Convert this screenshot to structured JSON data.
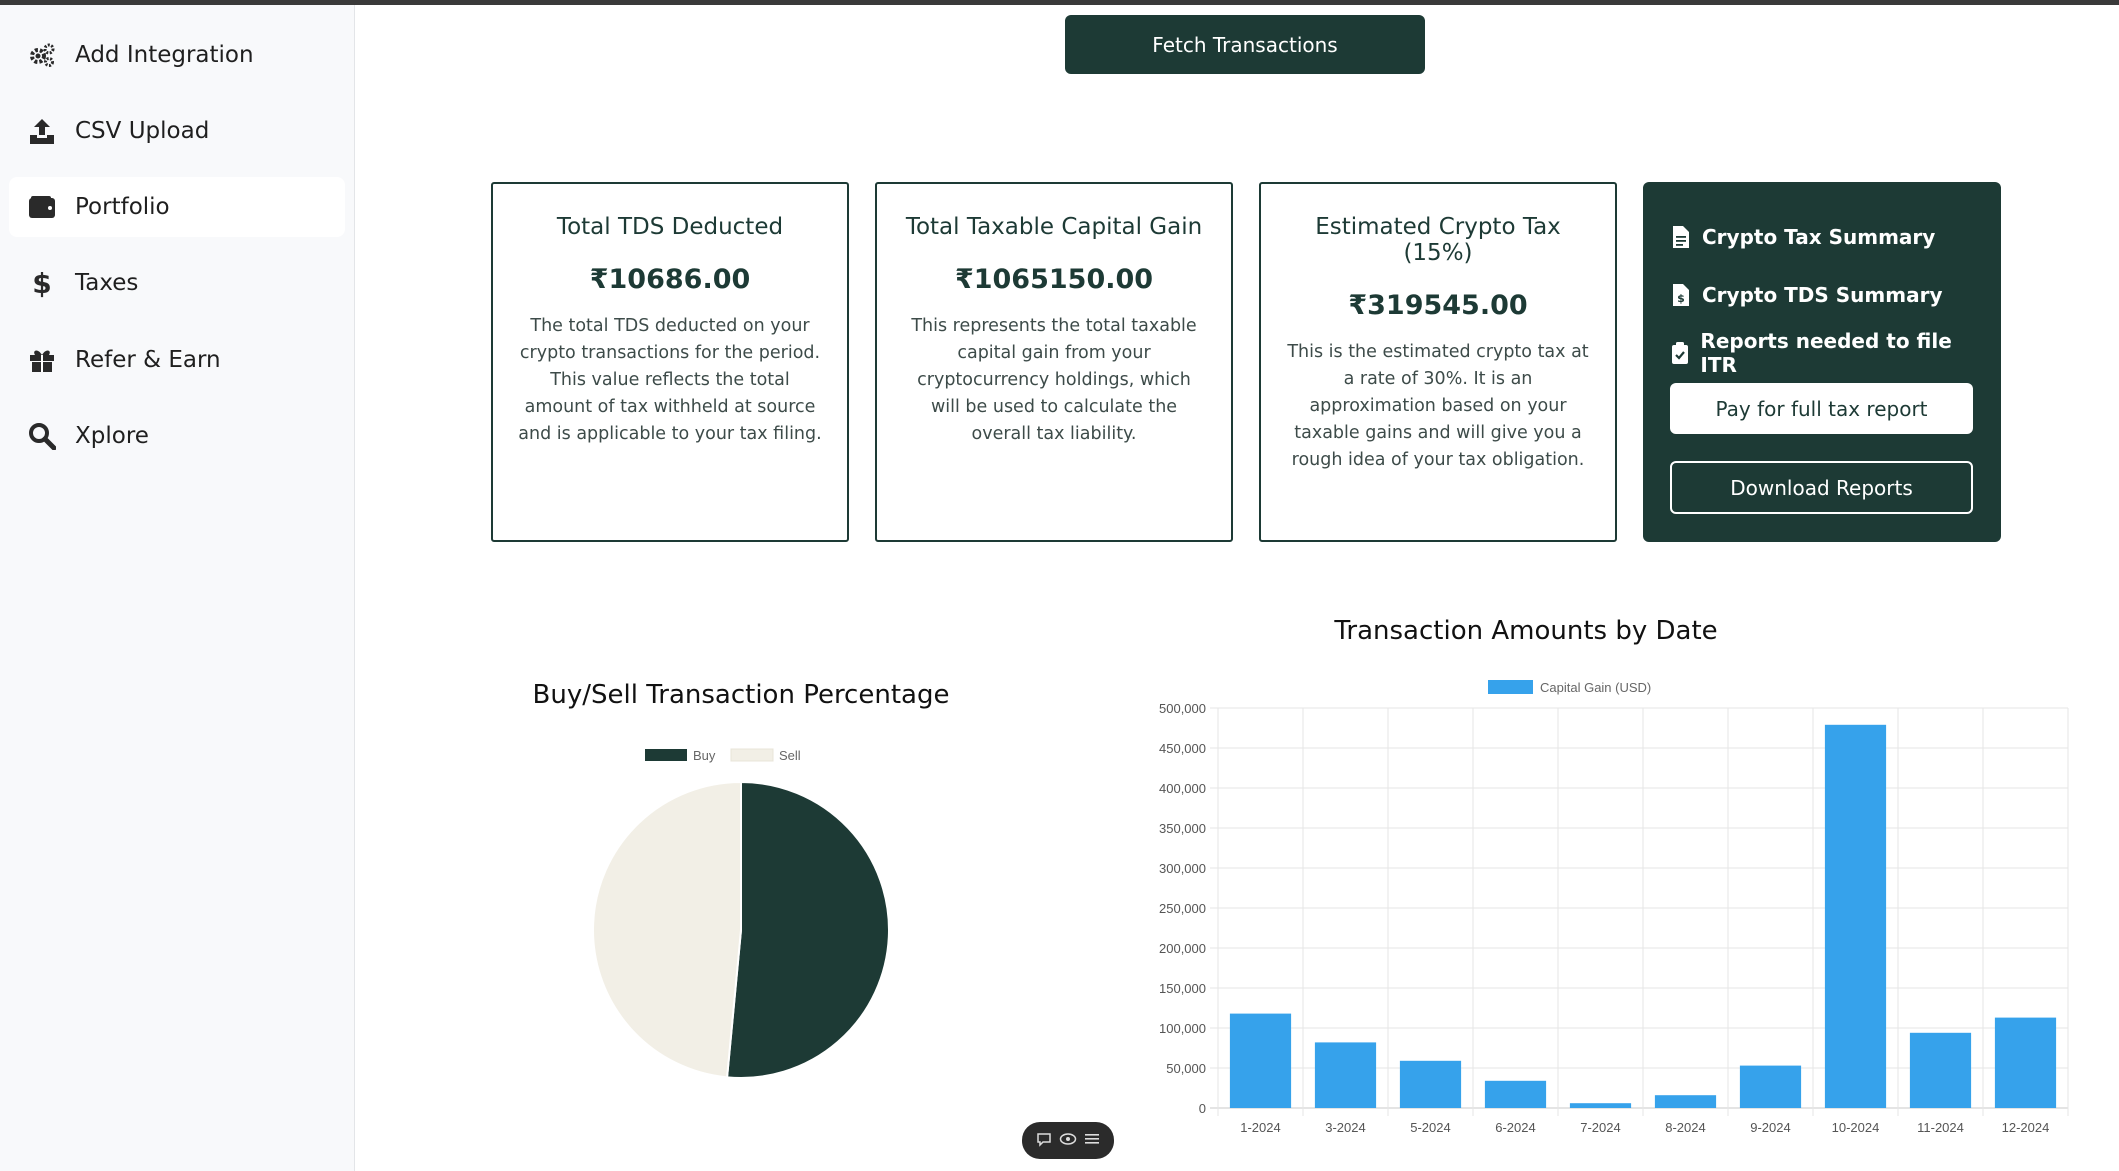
{
  "sidebar": {
    "items": [
      {
        "label": "Add Integration",
        "icon": "gears-icon"
      },
      {
        "label": "CSV Upload",
        "icon": "upload-icon"
      },
      {
        "label": "Portfolio",
        "icon": "wallet-icon"
      },
      {
        "label": "Taxes",
        "icon": "dollar-icon"
      },
      {
        "label": "Refer & Earn",
        "icon": "gift-icon"
      },
      {
        "label": "Xplore",
        "icon": "search-icon"
      }
    ],
    "active": "Portfolio"
  },
  "fetch_button": "Fetch Transactions",
  "cards": [
    {
      "title": "Total TDS Deducted",
      "value": "₹10686.00",
      "desc": "The total TDS deducted on your crypto transactions for the period. This value reflects the total amount of tax withheld at source and is applicable to your tax filing."
    },
    {
      "title": "Total Taxable Capital Gain",
      "value": "₹1065150.00",
      "desc": "This represents the total taxable capital gain from your cryptocurrency holdings, which will be used to calculate the overall tax liability."
    },
    {
      "title": "Estimated Crypto Tax (15%)",
      "value": "₹319545.00",
      "desc": "This is the estimated crypto tax at a rate of 30%. It is an approximation based on your taxable gains and will give you a rough idea of your tax obligation."
    }
  ],
  "reports": {
    "links": [
      {
        "label": "Crypto Tax Summary",
        "icon": "document-icon"
      },
      {
        "label": "Crypto TDS Summary",
        "icon": "invoice-icon"
      },
      {
        "label": "Reports needed to file ITR",
        "icon": "clipboard-check-icon"
      }
    ],
    "pay_button": "Pay for full tax report",
    "download_button": "Download Reports"
  },
  "colors": {
    "brand": "#1d3a35",
    "bar": "#36a2eb",
    "sell": "#f2efe6"
  },
  "chart_data": [
    {
      "type": "pie",
      "title": "Buy/Sell Transaction Percentage",
      "labels": [
        "Buy",
        "Sell"
      ],
      "values": [
        51.5,
        48.5
      ],
      "colors": [
        "#1d3a35",
        "#f2efe6"
      ],
      "legend": "top"
    },
    {
      "type": "bar",
      "title": "Transaction Amounts by Date",
      "categories": [
        "1-2024",
        "3-2024",
        "5-2024",
        "6-2024",
        "7-2024",
        "8-2024",
        "9-2024",
        "10-2024",
        "11-2024",
        "12-2024"
      ],
      "series": [
        {
          "name": "Capital Gain (USD)",
          "values": [
            118000,
            82000,
            59000,
            34000,
            6000,
            16000,
            53000,
            479000,
            94000,
            113000
          ]
        }
      ],
      "ylim": [
        0,
        500000
      ],
      "yticks": [
        "500,000",
        "450,000",
        "400,000",
        "350,000",
        "300,000",
        "250,000",
        "200,000",
        "150,000",
        "100,000",
        "50,000",
        "0"
      ],
      "grid": true,
      "legend": "top"
    }
  ]
}
